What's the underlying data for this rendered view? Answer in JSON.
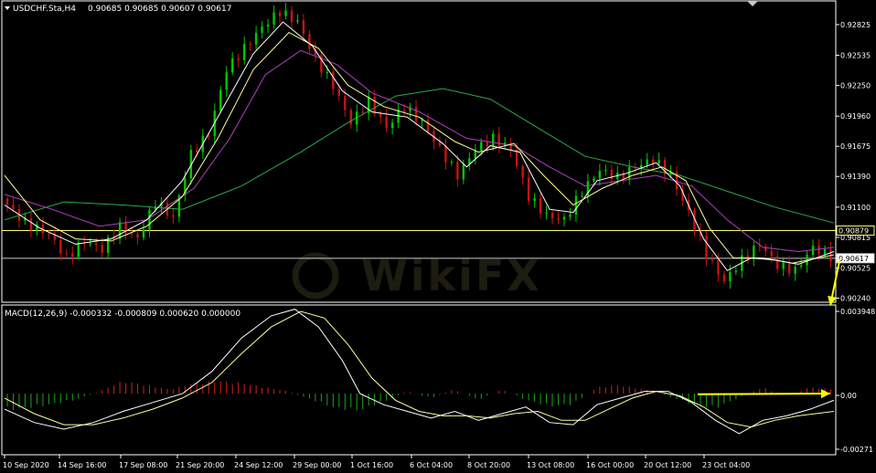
{
  "window": {
    "symbol_label": "USDCHF.Sta,H4",
    "ohlc_label": "0.90685 0.90685 0.90607 0.90617"
  },
  "macd": {
    "label": "MACD(12,26,9) -0.000332 -0.000809 0.000620 0.000000",
    "scale": {
      "top": "0.003948",
      "zero": "0.00",
      "bottom": "-0.00271"
    }
  },
  "watermark": "WikiFX",
  "colors": {
    "background": "#000000",
    "frame": "#ffffff",
    "bull_candle": "#00c800",
    "bear_candle": "#c81414",
    "ma_fast": "#ffffff",
    "ma_mid": "#ffff99",
    "ma_slow": "#b040c0",
    "ma_long": "#2ea84a",
    "hline_resistance": "#ffff66",
    "hline_current": "#cccccc",
    "hist_positive": "#d82020",
    "hist_negative": "#20a020",
    "macd_line": "#ffffff",
    "signal_line": "#ffff99",
    "arrow": "#ffff00"
  },
  "chart_data": {
    "type": "candlestick",
    "symbol": "USDCHF.Sta",
    "timeframe": "H4",
    "ohlc": {
      "open": 0.90685,
      "high": 0.90685,
      "low": 0.90607,
      "close": 0.90617
    },
    "price_axis": {
      "ylim": [
        0.9021,
        0.9304
      ],
      "ticks": [
        "0.92825",
        "0.92535",
        "0.92250",
        "0.91960",
        "0.91675",
        "0.91390",
        "0.91100",
        "0.90815",
        "0.90525",
        "0.90240"
      ]
    },
    "highlighted_prices": [
      {
        "label": "0.90879",
        "value": 0.90879
      },
      {
        "label": "0.90617",
        "value": 0.90617
      }
    ],
    "time_axis": {
      "labels": [
        "10 Sep 2020",
        "14 Sep 16:00",
        "17 Sep 08:00",
        "21 Sep 20:00",
        "24 Sep 12:00",
        "29 Sep 00:00",
        "1 Oct 16:00",
        "6 Oct 04:00",
        "8 Oct 20:00",
        "13 Oct 08:00",
        "16 Oct 00:00",
        "20 Oct 12:00",
        "23 Oct 04:00"
      ]
    },
    "price_path": [
      [
        0,
        0.9118
      ],
      [
        4,
        0.9095
      ],
      [
        8,
        0.9085
      ],
      [
        11,
        0.9062
      ],
      [
        14,
        0.9078
      ],
      [
        17,
        0.907
      ],
      [
        20,
        0.9092
      ],
      [
        23,
        0.908
      ],
      [
        26,
        0.9115
      ],
      [
        29,
        0.91
      ],
      [
        32,
        0.916
      ],
      [
        35,
        0.918
      ],
      [
        38,
        0.924
      ],
      [
        41,
        0.926
      ],
      [
        44,
        0.928
      ],
      [
        47,
        0.9295
      ],
      [
        50,
        0.9285
      ],
      [
        53,
        0.925
      ],
      [
        56,
        0.9225
      ],
      [
        59,
        0.919
      ],
      [
        62,
        0.921
      ],
      [
        65,
        0.9185
      ],
      [
        68,
        0.9205
      ],
      [
        71,
        0.919
      ],
      [
        74,
        0.9165
      ],
      [
        77,
        0.914
      ],
      [
        80,
        0.9165
      ],
      [
        83,
        0.9175
      ],
      [
        86,
        0.9165
      ],
      [
        89,
        0.912
      ],
      [
        92,
        0.9102
      ],
      [
        95,
        0.9098
      ],
      [
        98,
        0.9125
      ],
      [
        101,
        0.9145
      ],
      [
        104,
        0.9138
      ],
      [
        107,
        0.9148
      ],
      [
        110,
        0.9155
      ],
      [
        113,
        0.914
      ],
      [
        116,
        0.9105
      ],
      [
        119,
        0.9065
      ],
      [
        122,
        0.904
      ],
      [
        125,
        0.906
      ],
      [
        128,
        0.9075
      ],
      [
        131,
        0.9055
      ],
      [
        134,
        0.905
      ],
      [
        137,
        0.9072
      ],
      [
        140,
        0.9063
      ]
    ],
    "ma_fast": [
      [
        0,
        0.9112
      ],
      [
        6,
        0.909
      ],
      [
        12,
        0.9075
      ],
      [
        18,
        0.908
      ],
      [
        24,
        0.9098
      ],
      [
        30,
        0.9135
      ],
      [
        36,
        0.9195
      ],
      [
        42,
        0.9255
      ],
      [
        47,
        0.9285
      ],
      [
        52,
        0.9262
      ],
      [
        57,
        0.922
      ],
      [
        62,
        0.92
      ],
      [
        68,
        0.9195
      ],
      [
        74,
        0.917
      ],
      [
        78,
        0.9148
      ],
      [
        82,
        0.9168
      ],
      [
        87,
        0.9162
      ],
      [
        92,
        0.9108
      ],
      [
        96,
        0.9105
      ],
      [
        100,
        0.9135
      ],
      [
        105,
        0.9142
      ],
      [
        110,
        0.9152
      ],
      [
        114,
        0.913
      ],
      [
        118,
        0.908
      ],
      [
        122,
        0.905
      ],
      [
        126,
        0.9062
      ],
      [
        130,
        0.906
      ],
      [
        134,
        0.9056
      ],
      [
        140,
        0.9068
      ]
    ],
    "ma_mid": [
      [
        0,
        0.914
      ],
      [
        6,
        0.9098
      ],
      [
        12,
        0.908
      ],
      [
        18,
        0.9078
      ],
      [
        24,
        0.9092
      ],
      [
        30,
        0.912
      ],
      [
        36,
        0.9175
      ],
      [
        42,
        0.924
      ],
      [
        48,
        0.9275
      ],
      [
        53,
        0.926
      ],
      [
        58,
        0.9225
      ],
      [
        64,
        0.9205
      ],
      [
        70,
        0.9195
      ],
      [
        76,
        0.9172
      ],
      [
        80,
        0.9162
      ],
      [
        86,
        0.917
      ],
      [
        91,
        0.914
      ],
      [
        96,
        0.9112
      ],
      [
        101,
        0.9128
      ],
      [
        106,
        0.914
      ],
      [
        111,
        0.9148
      ],
      [
        115,
        0.9135
      ],
      [
        119,
        0.909
      ],
      [
        123,
        0.9062
      ],
      [
        128,
        0.9062
      ],
      [
        133,
        0.9057
      ],
      [
        140,
        0.9065
      ]
    ],
    "ma_slow": [
      [
        0,
        0.9122
      ],
      [
        8,
        0.9108
      ],
      [
        16,
        0.9092
      ],
      [
        24,
        0.9098
      ],
      [
        32,
        0.9128
      ],
      [
        38,
        0.9175
      ],
      [
        44,
        0.9235
      ],
      [
        50,
        0.9258
      ],
      [
        56,
        0.9245
      ],
      [
        62,
        0.9218
      ],
      [
        70,
        0.92
      ],
      [
        78,
        0.9175
      ],
      [
        86,
        0.9168
      ],
      [
        92,
        0.9148
      ],
      [
        98,
        0.913
      ],
      [
        104,
        0.9135
      ],
      [
        110,
        0.914
      ],
      [
        116,
        0.913
      ],
      [
        122,
        0.9098
      ],
      [
        128,
        0.9072
      ],
      [
        134,
        0.9068
      ],
      [
        140,
        0.9072
      ]
    ],
    "ma_long": [
      [
        0,
        0.9098
      ],
      [
        10,
        0.9115
      ],
      [
        20,
        0.9112
      ],
      [
        30,
        0.9108
      ],
      [
        40,
        0.913
      ],
      [
        50,
        0.9162
      ],
      [
        58,
        0.919
      ],
      [
        66,
        0.9215
      ],
      [
        74,
        0.9222
      ],
      [
        82,
        0.9212
      ],
      [
        90,
        0.9185
      ],
      [
        98,
        0.9158
      ],
      [
        106,
        0.9148
      ],
      [
        114,
        0.914
      ],
      [
        122,
        0.9125
      ],
      [
        130,
        0.911
      ],
      [
        140,
        0.9095
      ]
    ],
    "macd_axis": {
      "ylim": [
        -0.00271,
        0.003948
      ]
    },
    "macd_line": [
      [
        0,
        -0.0007
      ],
      [
        5,
        -0.0013
      ],
      [
        10,
        -0.0016
      ],
      [
        15,
        -0.0013
      ],
      [
        20,
        -0.0008
      ],
      [
        25,
        -0.0004
      ],
      [
        30,
        0.0
      ],
      [
        35,
        0.001
      ],
      [
        40,
        0.0025
      ],
      [
        45,
        0.0035
      ],
      [
        49,
        0.0038
      ],
      [
        53,
        0.003
      ],
      [
        57,
        0.0015
      ],
      [
        60,
        0.0
      ],
      [
        64,
        -0.0005
      ],
      [
        68,
        -0.0008
      ],
      [
        72,
        -0.0011
      ],
      [
        76,
        -0.0008
      ],
      [
        80,
        -0.0012
      ],
      [
        84,
        -0.0009
      ],
      [
        88,
        -0.0006
      ],
      [
        92,
        -0.0013
      ],
      [
        96,
        -0.0014
      ],
      [
        100,
        -0.0005
      ],
      [
        104,
        -0.0002
      ],
      [
        108,
        0.0001
      ],
      [
        112,
        0.0001
      ],
      [
        116,
        -0.0004
      ],
      [
        120,
        -0.0012
      ],
      [
        124,
        -0.0018
      ],
      [
        128,
        -0.0012
      ],
      [
        132,
        -0.001
      ],
      [
        136,
        -0.0007
      ],
      [
        140,
        -0.0003
      ]
    ],
    "signal_line": [
      [
        0,
        -0.0002
      ],
      [
        5,
        -0.0009
      ],
      [
        10,
        -0.0014
      ],
      [
        15,
        -0.0014
      ],
      [
        20,
        -0.0011
      ],
      [
        25,
        -0.0007
      ],
      [
        30,
        -0.0002
      ],
      [
        35,
        0.0005
      ],
      [
        40,
        0.0018
      ],
      [
        45,
        0.003
      ],
      [
        50,
        0.0037
      ],
      [
        54,
        0.0034
      ],
      [
        58,
        0.0022
      ],
      [
        62,
        0.0007
      ],
      [
        66,
        -0.0003
      ],
      [
        70,
        -0.0008
      ],
      [
        74,
        -0.001
      ],
      [
        78,
        -0.001
      ],
      [
        82,
        -0.0011
      ],
      [
        86,
        -0.0009
      ],
      [
        90,
        -0.0008
      ],
      [
        94,
        -0.0012
      ],
      [
        98,
        -0.0012
      ],
      [
        102,
        -0.0007
      ],
      [
        106,
        -0.0002
      ],
      [
        110,
        0.0001
      ],
      [
        114,
        -0.0001
      ],
      [
        118,
        -0.0006
      ],
      [
        122,
        -0.0013
      ],
      [
        126,
        -0.0015
      ],
      [
        130,
        -0.0012
      ],
      [
        134,
        -0.001
      ],
      [
        140,
        -0.0008
      ]
    ],
    "macd_histogram_envelope": [
      [
        0,
        -0.0008
      ],
      [
        6,
        -0.0006
      ],
      [
        12,
        -0.0003
      ],
      [
        16,
        0.0001
      ],
      [
        20,
        0.0006
      ],
      [
        24,
        0.0004
      ],
      [
        28,
        0.0002
      ],
      [
        32,
        0.0005
      ],
      [
        36,
        0.0006
      ],
      [
        40,
        0.0005
      ],
      [
        44,
        0.0003
      ],
      [
        48,
        0.0001
      ],
      [
        52,
        -0.0003
      ],
      [
        56,
        -0.0007
      ],
      [
        60,
        -0.0008
      ],
      [
        64,
        -0.0004
      ],
      [
        68,
        0.0001
      ],
      [
        72,
        -0.0002
      ],
      [
        76,
        0.0002
      ],
      [
        80,
        -0.0003
      ],
      [
        84,
        0.0002
      ],
      [
        88,
        -0.0003
      ],
      [
        92,
        -0.0006
      ],
      [
        96,
        -0.0005
      ],
      [
        100,
        0.0003
      ],
      [
        104,
        0.0004
      ],
      [
        108,
        0.0002
      ],
      [
        112,
        -0.0001
      ],
      [
        116,
        -0.0005
      ],
      [
        120,
        -0.0007
      ],
      [
        124,
        -0.0002
      ],
      [
        128,
        0.0003
      ],
      [
        132,
        -0.0001
      ],
      [
        136,
        0.0003
      ],
      [
        140,
        0.0002
      ]
    ],
    "annotations": [
      {
        "type": "arrow",
        "pane": "price",
        "from": [
          141,
          0.9061
        ],
        "to": [
          150,
          0.9017
        ]
      },
      {
        "type": "arrow",
        "pane": "macd",
        "from": [
          117,
          -3e-05
        ],
        "to": [
          152,
          0.0
        ]
      }
    ]
  }
}
